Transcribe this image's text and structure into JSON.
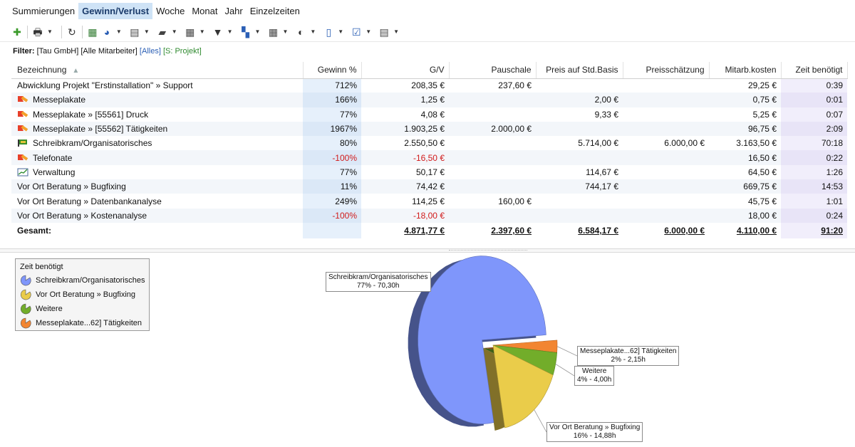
{
  "tabs": [
    {
      "label": "Summierungen",
      "active": false
    },
    {
      "label": "Gewinn/Verlust",
      "active": true
    },
    {
      "label": "Woche",
      "active": false
    },
    {
      "label": "Monat",
      "active": false
    },
    {
      "label": "Jahr",
      "active": false
    },
    {
      "label": "Einzelzeiten",
      "active": false
    }
  ],
  "toolbar": [
    {
      "icon": "add-icon",
      "glyph": "✚",
      "color": "#3a9a2a",
      "dropdown": false
    },
    {
      "icon": "print-icon",
      "glyph": "🖶",
      "color": "#333333",
      "dropdown": true
    },
    {
      "icon": "refresh-icon",
      "glyph": "↻",
      "color": "#333333",
      "dropdown": false
    },
    {
      "icon": "excel-export-icon",
      "glyph": "▦",
      "color": "#2f7a2f",
      "dropdown": false
    },
    {
      "icon": "pie-chart-icon",
      "glyph": "◕",
      "color": "#2b5fb5",
      "dropdown": true
    },
    {
      "icon": "calculator-icon",
      "glyph": "▤",
      "color": "#444444",
      "dropdown": true
    },
    {
      "icon": "folder-icon",
      "glyph": "▰",
      "color": "#444444",
      "dropdown": true
    },
    {
      "icon": "calendar-icon",
      "glyph": "▦",
      "color": "#444444",
      "dropdown": true
    },
    {
      "icon": "filter-icon",
      "glyph": "▼",
      "color": "#333333",
      "dropdown": true
    },
    {
      "icon": "group-icon",
      "glyph": "▚",
      "color": "#2b5fb5",
      "dropdown": true
    },
    {
      "icon": "table-icon",
      "glyph": "▦",
      "color": "#444444",
      "dropdown": true
    },
    {
      "icon": "currency-icon",
      "glyph": "◐",
      "color": "#333333",
      "dropdown": true
    },
    {
      "icon": "device-icon",
      "glyph": "▯",
      "color": "#2b5fb5",
      "dropdown": true
    },
    {
      "icon": "checklist-icon",
      "glyph": "☑",
      "color": "#2b5fb5",
      "dropdown": true
    },
    {
      "icon": "report-icon",
      "glyph": "▤",
      "color": "#444444",
      "dropdown": true
    }
  ],
  "filter": {
    "label": "Filter:",
    "company": "[Tau GmbH]",
    "employees": "[Alle Mitarbeiter]",
    "all": "[Alles]",
    "project": "[S: Projekt]"
  },
  "table": {
    "columns": [
      "Bezeichnung",
      "Gewinn %",
      "G/V",
      "Pauschale",
      "Preis auf Std.Basis",
      "Preisschätzung",
      "Mitarb.kosten",
      "Zeit benötigt"
    ],
    "rows": [
      {
        "icon": "",
        "name": "Abwicklung Projekt \"Erstinstallation\" » Support",
        "gewinn": "712%",
        "gv": "208,35 €",
        "pauschale": "237,60 €",
        "preis": "",
        "schaetzung": "",
        "kosten": "29,25 €",
        "zeit": "0:39",
        "neg": false
      },
      {
        "icon": "pencil-flag-icon",
        "name": "Messeplakate",
        "gewinn": "166%",
        "gv": "1,25 €",
        "pauschale": "",
        "preis": "2,00 €",
        "schaetzung": "",
        "kosten": "0,75 €",
        "zeit": "0:01",
        "neg": false
      },
      {
        "icon": "pencil-flag-icon",
        "name": "Messeplakate » [55561] Druck",
        "gewinn": "77%",
        "gv": "4,08 €",
        "pauschale": "",
        "preis": "9,33 €",
        "schaetzung": "",
        "kosten": "5,25 €",
        "zeit": "0:07",
        "neg": false
      },
      {
        "icon": "pencil-flag-icon",
        "name": "Messeplakate » [55562] Tätigkeiten",
        "gewinn": "1967%",
        "gv": "1.903,25 €",
        "pauschale": "2.000,00 €",
        "preis": "",
        "schaetzung": "",
        "kosten": "96,75 €",
        "zeit": "2:09",
        "neg": false
      },
      {
        "icon": "green-flag-icon",
        "name": "Schreibkram/Organisatorisches",
        "gewinn": "80%",
        "gv": "2.550,50 €",
        "pauschale": "",
        "preis": "5.714,00 €",
        "schaetzung": "6.000,00 €",
        "kosten": "3.163,50 €",
        "zeit": "70:18",
        "neg": false
      },
      {
        "icon": "pencil-flag-icon",
        "name": "Telefonate",
        "gewinn": "-100%",
        "gv": "-16,50 €",
        "pauschale": "",
        "preis": "",
        "schaetzung": "",
        "kosten": "16,50 €",
        "zeit": "0:22",
        "neg": true
      },
      {
        "icon": "chart-line-icon",
        "name": "Verwaltung",
        "gewinn": "77%",
        "gv": "50,17 €",
        "pauschale": "",
        "preis": "114,67 €",
        "schaetzung": "",
        "kosten": "64,50 €",
        "zeit": "1:26",
        "neg": false
      },
      {
        "icon": "",
        "name": "Vor Ort Beratung » Bugfixing",
        "gewinn": "11%",
        "gv": "74,42 €",
        "pauschale": "",
        "preis": "744,17 €",
        "schaetzung": "",
        "kosten": "669,75 €",
        "zeit": "14:53",
        "neg": false
      },
      {
        "icon": "",
        "name": "Vor Ort Beratung » Datenbankanalyse",
        "gewinn": "249%",
        "gv": "114,25 €",
        "pauschale": "160,00 €",
        "preis": "",
        "schaetzung": "",
        "kosten": "45,75 €",
        "zeit": "1:01",
        "neg": false
      },
      {
        "icon": "",
        "name": "Vor Ort Beratung » Kostenanalyse",
        "gewinn": "-100%",
        "gv": "-18,00 €",
        "pauschale": "",
        "preis": "",
        "schaetzung": "",
        "kosten": "18,00 €",
        "zeit": "0:24",
        "neg": true
      }
    ],
    "total": {
      "name": "Gesamt:",
      "gewinn": "",
      "gv": "4.871,77 €",
      "pauschale": "2.397,60 €",
      "preis": "6.584,17 €",
      "schaetzung": "6.000,00 €",
      "kosten": "4.110,00 €",
      "zeit": "91:20"
    }
  },
  "legend": {
    "title": "Zeit benötigt",
    "items": [
      {
        "label": "Schreibkram/Organisatorisches",
        "color": "#7f96fb"
      },
      {
        "label": "Vor Ort Beratung » Bugfixing",
        "color": "#eacc4a"
      },
      {
        "label": "Weitere",
        "color": "#72ad2a"
      },
      {
        "label": "Messeplakate...62] Tätigkeiten",
        "color": "#f28531"
      }
    ]
  },
  "chart_data": {
    "type": "pie",
    "title": "Zeit benötigt",
    "slices": [
      {
        "name": "Schreibkram/Organisatorisches",
        "value": 70.3,
        "percent": 77,
        "label_line2": "77% - 70,30h",
        "color": "#7f96fb",
        "exploded": true
      },
      {
        "name": "Vor Ort Beratung » Bugfixing",
        "value": 14.88,
        "percent": 16,
        "label_line2": "16% - 14,88h",
        "color": "#eacc4a",
        "exploded": false
      },
      {
        "name": "Weitere",
        "value": 4.0,
        "percent": 4,
        "label_line2": "4% - 4,00h",
        "color": "#72ad2a",
        "exploded": false
      },
      {
        "name": "Messeplakate...62] Tätigkeiten",
        "value": 2.15,
        "percent": 2,
        "label_line2": "2% - 2,15h",
        "color": "#f28531",
        "exploded": false
      }
    ]
  }
}
